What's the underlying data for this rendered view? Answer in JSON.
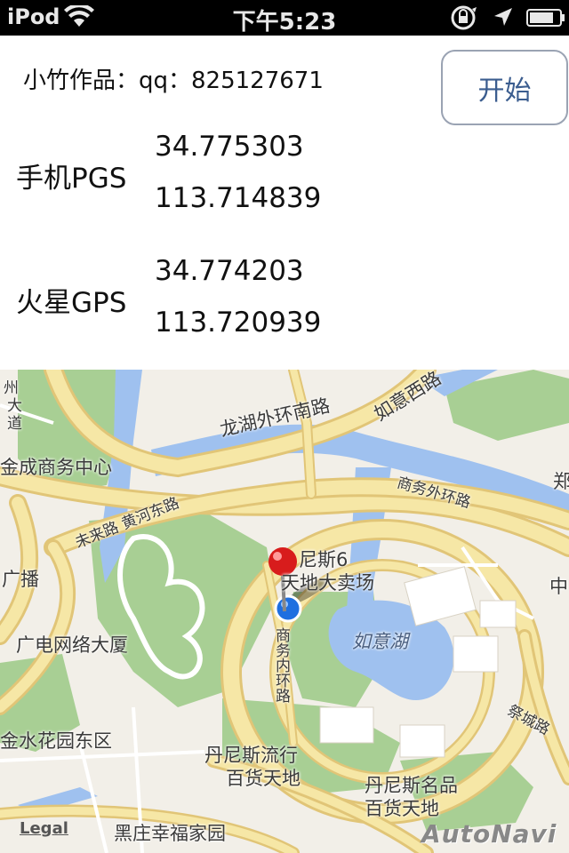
{
  "status_bar": {
    "carrier": "iPod",
    "time": "下午5:23"
  },
  "panel": {
    "author": "小竹作品：qq：825127671",
    "start_button": "开始",
    "phone_label": "手机PGS",
    "phone_lat": "34.775303",
    "phone_lng": "113.714839",
    "mars_label": "火星GPS",
    "mars_lat": "34.774203",
    "mars_lng": "113.720939"
  },
  "map": {
    "labels": {
      "long_lake_south": "龙湖外环南路",
      "ruyi_west": "如意西路",
      "jincheng": "金成商务中心",
      "weilai_huanghe": "未来路 黄河东路",
      "business_ring": "商务外环路",
      "zheng": "郑",
      "broadcast": "广播",
      "dennis6_line1": "尼斯6",
      "dennis6_line2": "天地大卖场",
      "zhong": "中",
      "radio_tv": "广电网络大厦",
      "business_inner": "商务内环路",
      "ruyi_lake": "如意湖",
      "jinshui_garden": "金水花园东区",
      "jicheng_road": "祭城路",
      "dennis_liuxing_1": "丹尼斯流行",
      "dennis_liuxing_2": "百货天地",
      "dennis_mingpin_1": "丹尼斯名品",
      "dennis_mingpin_2": "百货天地",
      "heizhuang": "黑庄幸福家园",
      "zhou": "州",
      "da": "大",
      "dao": "道"
    },
    "legal": "Legal",
    "provider": "AutoNavi",
    "colors": {
      "road": "#f6e7a6",
      "road_edge": "#e1c577",
      "park": "#a8cf94",
      "water": "#9fc1ef",
      "background": "#f2efe8"
    }
  }
}
